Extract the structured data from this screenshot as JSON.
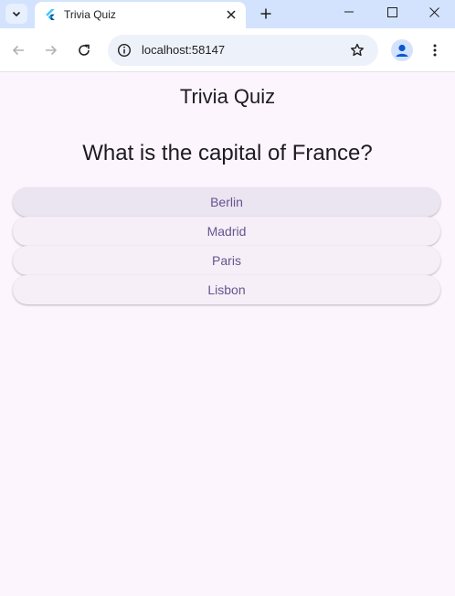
{
  "browser": {
    "tab": {
      "title": "Trivia Quiz"
    },
    "address_bar": {
      "url": "localhost:58147"
    }
  },
  "quiz": {
    "app_title": "Trivia Quiz",
    "question": "What is the capital of France?",
    "answers": [
      "Berlin",
      "Madrid",
      "Paris",
      "Lisbon"
    ]
  },
  "colors": {
    "page_background": "#fcf5fd",
    "button_background": "#f6eff7",
    "button_hover_background": "#ebe4f1",
    "button_text": "#65558f",
    "tabstrip": "#d3e3fd"
  }
}
